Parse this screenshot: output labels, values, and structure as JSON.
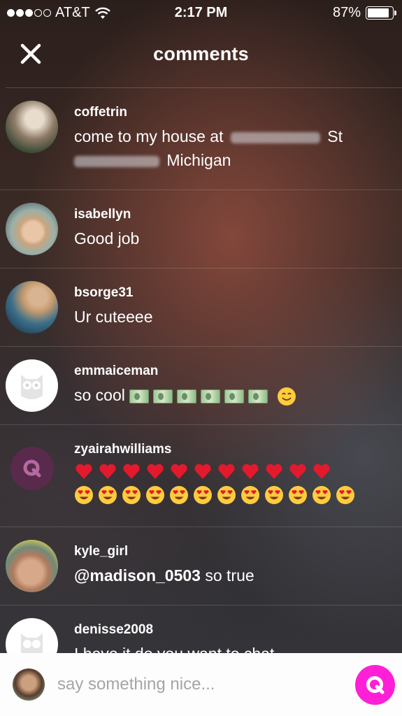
{
  "status_bar": {
    "carrier": "AT&T",
    "time": "2:17 PM",
    "battery_text": "87%",
    "battery_level": 0.87
  },
  "header": {
    "title": "comments"
  },
  "comments": [
    {
      "username": "coffetrin",
      "text_start": "come to my house at ",
      "text_mid": " St",
      "text_end": " Michigan"
    },
    {
      "username": "isabellyn",
      "text": "Good job"
    },
    {
      "username": "bsorge31",
      "text": "Ur cuteeee"
    },
    {
      "username": "emmaiceman",
      "text": "so cool "
    },
    {
      "username": "zyairahwilliams",
      "hearts": 11,
      "heart_faces": 12
    },
    {
      "username": "kyle_girl",
      "mention": "@madison_0503",
      "text": " so true"
    },
    {
      "username": "denisse2008",
      "text": "I have it do you want to chat"
    }
  ],
  "composer": {
    "placeholder": "say something nice..."
  },
  "colors": {
    "accent": "#ff1fd6",
    "q_avatar": "#5a2a4c"
  },
  "icons": {
    "close": "close-icon",
    "send": "q-logo-icon",
    "wifi": "wifi-icon",
    "battery": "battery-icon",
    "owl": "owl-placeholder-icon"
  }
}
